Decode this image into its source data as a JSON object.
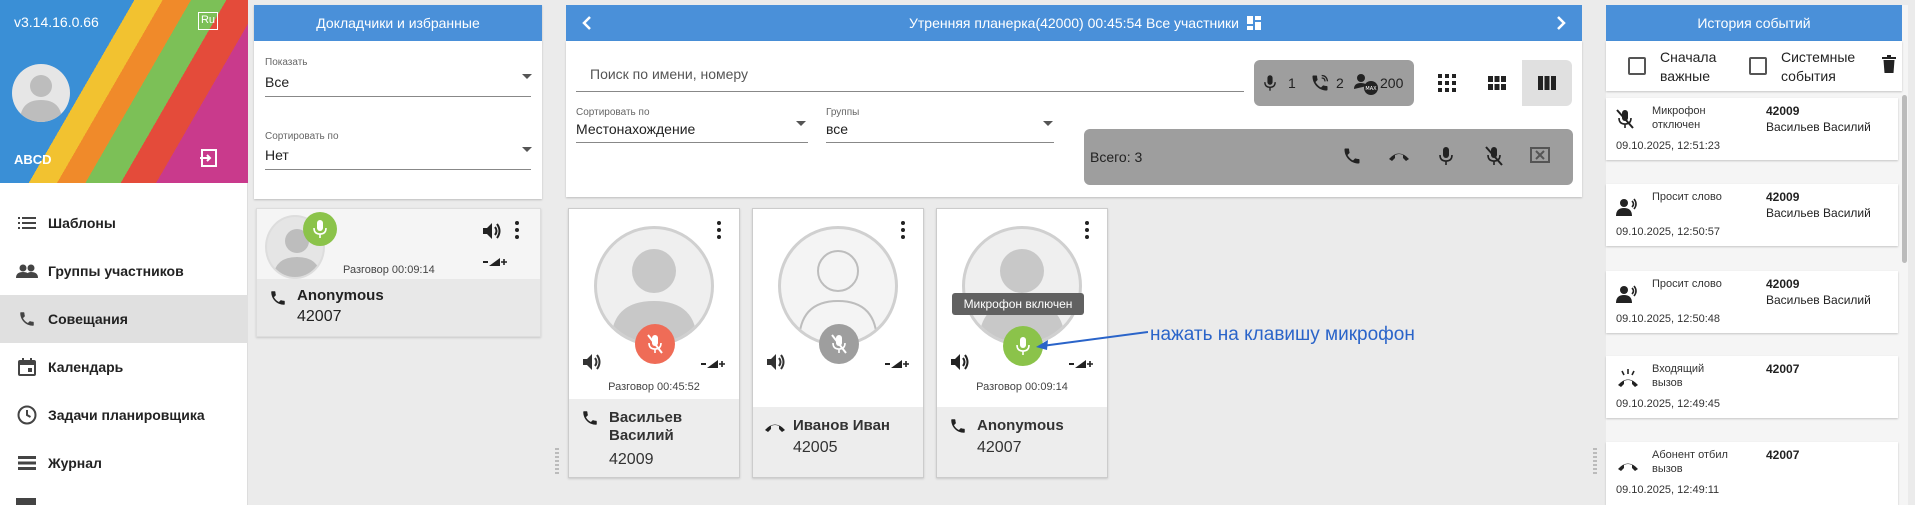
{
  "nav": {
    "version": "v3.14.16.0.66",
    "lang_badge": "Ru",
    "user_name": "ABCD",
    "items": [
      {
        "label": "Шаблоны",
        "icon": "list-icon"
      },
      {
        "label": "Группы участников",
        "icon": "people-icon"
      },
      {
        "label": "Совещания",
        "icon": "phone-icon",
        "active": true
      },
      {
        "label": "Календарь",
        "icon": "calendar-icon"
      },
      {
        "label": "Задачи планировщика",
        "icon": "clock-icon"
      },
      {
        "label": "Журнал",
        "icon": "journal-icon"
      }
    ]
  },
  "speakers": {
    "title": "Докладчики и избранные",
    "show": {
      "label": "Показать",
      "value": "Все"
    },
    "sort": {
      "label": "Сортировать по",
      "value": "Нет"
    },
    "card": {
      "talk": "Разговор 00:09:14",
      "name": "Anonymous",
      "number": "42007"
    }
  },
  "conference": {
    "title": "Утренняя планерка(42000)   00:45:54   Все участники",
    "search_placeholder": "Поиск по имени, номеру",
    "stats": {
      "mic": "1",
      "calls": "2",
      "max": "200"
    },
    "sort": {
      "label": "Сортировать по",
      "value": "Местонахождение"
    },
    "groups": {
      "label": "Группы",
      "value": "все"
    },
    "total": "Всего: 3",
    "participants": [
      {
        "name": "Васильев Василий",
        "number": "42009",
        "talk": "Разговор 00:45:52",
        "mic": "muted-red",
        "status": "phone"
      },
      {
        "name": "Иванов Иван",
        "number": "42005",
        "talk": "",
        "mic": "muted-grey",
        "status": "hangup"
      },
      {
        "name": "Anonymous",
        "number": "42007",
        "talk": "Разговор 00:09:14",
        "mic": "on-green",
        "status": "phone"
      }
    ],
    "tooltip": "Микрофон включен",
    "annotation": "нажать на клавишу микрофон"
  },
  "history": {
    "title": "История событий",
    "filter_important": "Сначала важные",
    "filter_system": "Системные события",
    "events": [
      {
        "type": "Микрофон отключен",
        "number": "42009",
        "user": "Васильев Василий",
        "time": "09.10.2025, 12:51:23",
        "icon": "mic-off-icon"
      },
      {
        "type": "Просит слово",
        "number": "42009",
        "user": "Васильев Василий",
        "time": "09.10.2025, 12:50:57",
        "icon": "raise-hand-icon"
      },
      {
        "type": "Просит слово",
        "number": "42009",
        "user": "Васильев Василий",
        "time": "09.10.2025, 12:50:48",
        "icon": "raise-hand-icon"
      },
      {
        "type": "Входящий вызов",
        "number": "42007",
        "user": "",
        "time": "09.10.2025, 12:49:45",
        "icon": "incoming-call-icon"
      },
      {
        "type": "Абонент отбил вызов",
        "number": "42007",
        "user": "",
        "time": "09.10.2025, 12:49:11",
        "icon": "hangup-icon"
      }
    ]
  },
  "colors": {
    "accent": "#4a90d9",
    "mic_on": "#8bc34a",
    "mic_off": "#ef6c57",
    "annotation": "#2a64c9"
  }
}
